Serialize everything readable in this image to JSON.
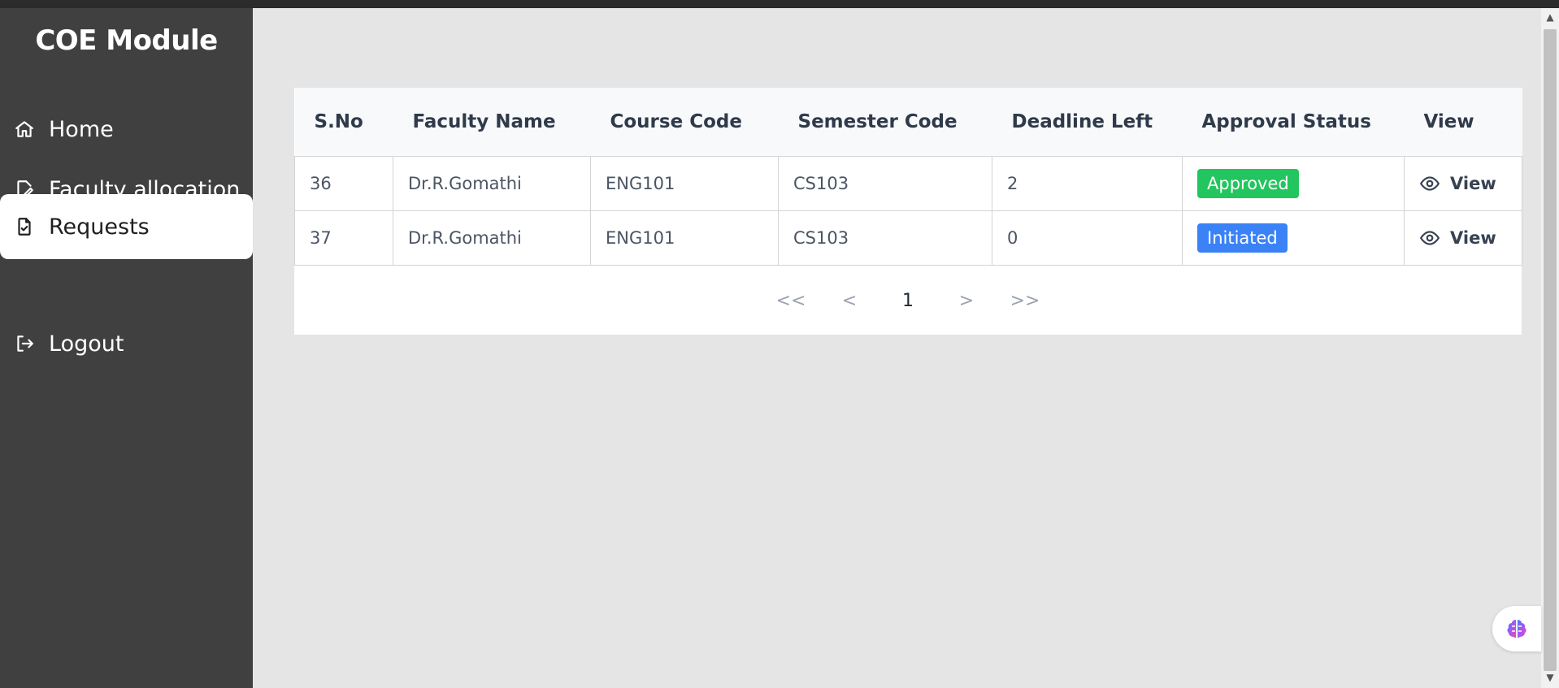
{
  "app": {
    "title": "COE Module"
  },
  "sidebar": {
    "items": [
      {
        "label": "Home",
        "icon": "home-icon"
      },
      {
        "label": "Faculty allocation",
        "icon": "edit-file-icon"
      },
      {
        "label": "Requests",
        "icon": "file-check-icon",
        "active": true
      },
      {
        "label": "Logout",
        "icon": "logout-icon"
      }
    ]
  },
  "table": {
    "columns": [
      "S.No",
      "Faculty Name",
      "Course Code",
      "Semester Code",
      "Deadline Left",
      "Approval Status",
      "View"
    ],
    "rows": [
      {
        "sno": "36",
        "faculty": "Dr.R.Gomathi",
        "course": "ENG101",
        "semester": "CS103",
        "deadline": "2",
        "status": "Approved",
        "status_color": "#22c55e",
        "view": "View"
      },
      {
        "sno": "37",
        "faculty": "Dr.R.Gomathi",
        "course": "ENG101",
        "semester": "CS103",
        "deadline": "0",
        "status": "Initiated",
        "status_color": "#3b82f6",
        "view": "View"
      }
    ]
  },
  "pagination": {
    "first": "<<",
    "prev": "<",
    "current": "1",
    "next": ">",
    "last": ">>"
  },
  "colors": {
    "sidebar_bg": "#404040",
    "page_bg": "#e5e5e5",
    "approved": "#22c55e",
    "initiated": "#3b82f6"
  }
}
